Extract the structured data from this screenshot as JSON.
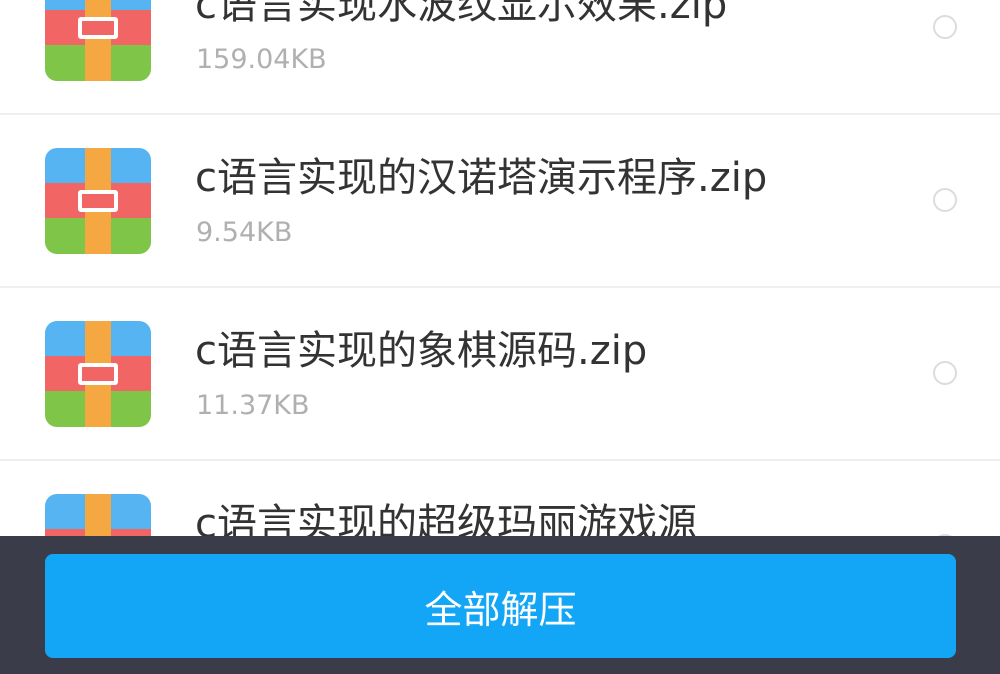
{
  "files": [
    {
      "name": "c语言实现水波纹显示效果.zip",
      "size": "159.04KB",
      "icon": "zip-archive-icon",
      "selected": false
    },
    {
      "name": "c语言实现的汉诺塔演示程序.zip",
      "size": "9.54KB",
      "icon": "zip-archive-icon",
      "selected": false
    },
    {
      "name": "c语言实现的象棋源码.zip",
      "size": "11.37KB",
      "icon": "zip-archive-icon",
      "selected": false
    },
    {
      "name": "c语言实现的超级玛丽游戏源",
      "size": "",
      "icon": "zip-archive-icon",
      "selected": false
    }
  ],
  "footer": {
    "extract_all_label": "全部解压"
  },
  "colors": {
    "accent": "#14a6f6",
    "footer_background": "#3a3d49",
    "file_name": "#333333",
    "file_size": "#b0b0b0"
  }
}
